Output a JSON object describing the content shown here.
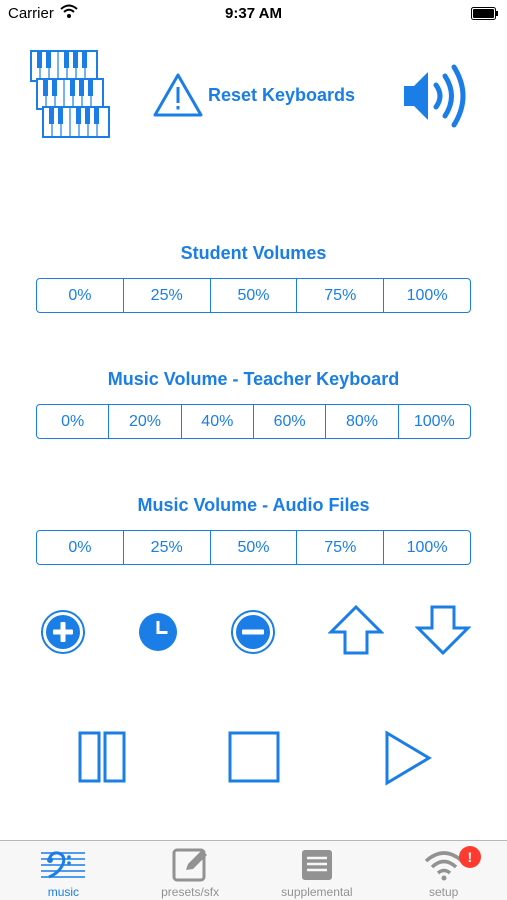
{
  "status": {
    "carrier": "Carrier",
    "time": "9:37 AM"
  },
  "header": {
    "reset_label": "Reset Keyboards"
  },
  "student_volumes": {
    "title": "Student Volumes",
    "options": [
      "0%",
      "25%",
      "50%",
      "75%",
      "100%"
    ]
  },
  "teacher_volume": {
    "title": "Music Volume - Teacher Keyboard",
    "options": [
      "0%",
      "20%",
      "40%",
      "60%",
      "80%",
      "100%"
    ]
  },
  "audio_volume": {
    "title": "Music Volume - Audio Files",
    "options": [
      "0%",
      "25%",
      "50%",
      "75%",
      "100%"
    ]
  },
  "controls": {
    "icons": [
      "plus-circle-icon",
      "clock-icon",
      "minus-circle-icon",
      "arrow-up-icon",
      "arrow-down-icon"
    ],
    "playback": [
      "pause-icon",
      "stop-icon",
      "play-icon"
    ]
  },
  "tabs": [
    {
      "label": "music",
      "icon": "bass-clef-staff-icon",
      "active": true
    },
    {
      "label": "presets/sfx",
      "icon": "edit-icon",
      "active": false
    },
    {
      "label": "supplemental",
      "icon": "list-icon",
      "active": false
    },
    {
      "label": "setup",
      "icon": "wifi-icon",
      "active": false,
      "badge": "!"
    }
  ],
  "colors": {
    "accent": "#1a7ee6",
    "tab_inactive": "#929292",
    "badge": "#ff3b30"
  }
}
